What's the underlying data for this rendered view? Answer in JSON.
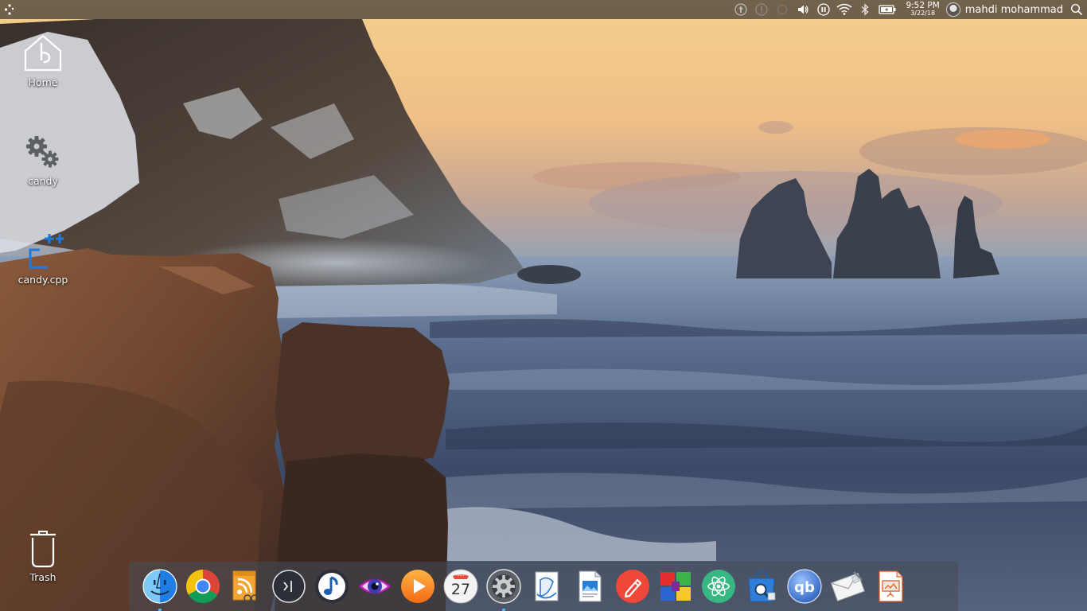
{
  "top_panel": {
    "clock": {
      "time": "9:52 PM",
      "date": "3/22/18"
    },
    "user": {
      "name": "mahdi mohammad"
    },
    "tray_icons": [
      "update-icon",
      "alert-icon",
      "circle-status-icon",
      "volume-icon",
      "media-pause-icon",
      "wifi-icon",
      "bluetooth-icon",
      "battery-icon"
    ]
  },
  "desktop": {
    "icons": [
      {
        "label": "Home",
        "icon": "home-folder-icon"
      },
      {
        "label": "candy",
        "icon": "gears-icon"
      },
      {
        "label": "candy.cpp",
        "icon": "cpp-file-icon"
      },
      {
        "label": "Trash",
        "icon": "trash-icon"
      }
    ]
  },
  "dock": {
    "items": [
      {
        "name": "finder",
        "icon": "finder-face-icon",
        "running": true
      },
      {
        "name": "chrome",
        "icon": "chrome-icon",
        "running": false
      },
      {
        "name": "rss-reader",
        "icon": "rss-reader-icon",
        "running": false
      },
      {
        "name": "terminal",
        "icon": "terminal-icon",
        "running": false
      },
      {
        "name": "music",
        "icon": "music-note-icon",
        "running": false
      },
      {
        "name": "screenshot-eye",
        "icon": "eye-icon",
        "running": false
      },
      {
        "name": "media-player",
        "icon": "play-icon",
        "running": false
      },
      {
        "name": "calendar",
        "icon": "calendar-icon",
        "running": false,
        "month": "OCT",
        "day": "27"
      },
      {
        "name": "system-settings",
        "icon": "settings-gear-icon",
        "running": true
      },
      {
        "name": "document-viewer",
        "icon": "document-viewer-icon",
        "running": false
      },
      {
        "name": "image-viewer",
        "icon": "image-document-icon",
        "running": false
      },
      {
        "name": "text-editor",
        "icon": "pencil-icon",
        "running": false
      },
      {
        "name": "windows-app",
        "icon": "windows-tiles-icon",
        "running": false
      },
      {
        "name": "atom",
        "icon": "atom-icon",
        "running": false
      },
      {
        "name": "software-store",
        "icon": "store-bag-icon",
        "running": false
      },
      {
        "name": "qbittorrent",
        "icon": "qbittorrent-icon",
        "running": false
      },
      {
        "name": "mail",
        "icon": "mail-envelope-icon",
        "running": false
      },
      {
        "name": "presentation",
        "icon": "presentation-icon",
        "running": false
      }
    ]
  },
  "colors": {
    "panel_bg": "#3e3732",
    "dock_bg": "#464c58",
    "running_indicator": "#5ab3ff"
  }
}
